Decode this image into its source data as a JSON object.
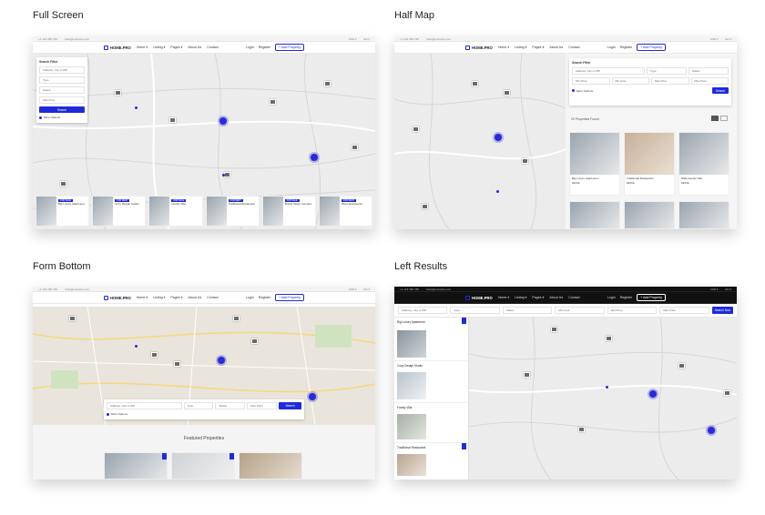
{
  "headings": {
    "full_screen": "Full Screen",
    "half_map": "Half Map",
    "form_bottom": "Form Bottom",
    "left_results": "Left Results"
  },
  "nav": {
    "logo": "HOME.PRO",
    "items": [
      "Home ▾",
      "Listing ▾",
      "Pages ▾",
      "About Us",
      "Contact"
    ],
    "login": "Login",
    "register": "Register",
    "add_property": "+ Add Property",
    "currency": "USD ▾",
    "lang": "EN ▾",
    "phone": "+1 123 456 789",
    "email": "hello@example.com"
  },
  "search": {
    "title": "Search Filter",
    "address_placeholder": "Address, City or ZIP",
    "type": "Type",
    "status": "Status",
    "min_price": "Min Price",
    "max_price": "Max Price",
    "min_area": "Min Area",
    "search_btn": "Search",
    "search_now": "Search Now",
    "more_options": "More Options"
  },
  "half_map": {
    "found": "20 Properties Found",
    "cards": [
      {
        "title": "Big Luxury Apartment",
        "details": "DETAIL"
      },
      {
        "title": "Traditional Restaurant",
        "details": "DETAIL"
      },
      {
        "title": "Wide Family Villa",
        "details": "DETAIL"
      }
    ]
  },
  "full_screen": {
    "cards": [
      {
        "badge": "FOR SALE",
        "title": "Big Luxury Apartment"
      },
      {
        "badge": "FOR RENT",
        "title": "Cozy Design Studio"
      },
      {
        "badge": "FOR SALE",
        "title": "Family Villa"
      },
      {
        "badge": "FOR RENT",
        "title": "Traditional Restaurant"
      },
      {
        "badge": "FOR SALE",
        "title": "Bristol Views Complex"
      },
      {
        "badge": "FOR RENT",
        "title": "River Apartments"
      }
    ]
  },
  "form_bottom": {
    "featured": "Featured Properties"
  },
  "left_results": {
    "list": [
      {
        "title": "Big Luxury Apartment"
      },
      {
        "title": "Cozy Design Studio"
      },
      {
        "title": "Family Villa"
      },
      {
        "title": "Traditional Restaurant"
      }
    ]
  }
}
